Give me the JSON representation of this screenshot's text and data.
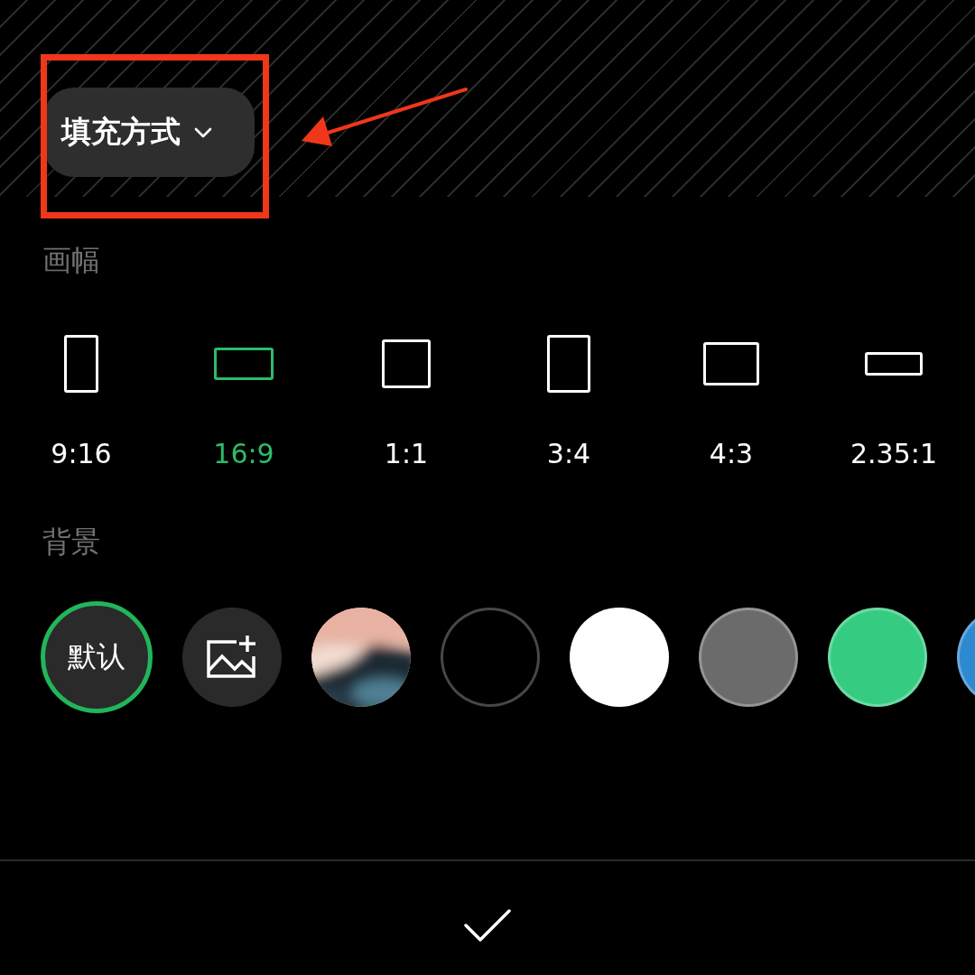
{
  "fill_mode_button": {
    "label": "填充方式"
  },
  "canvas_section": {
    "title": "画幅"
  },
  "aspect_ratios": [
    {
      "label": "9:16",
      "kind": "tall",
      "selected": false
    },
    {
      "label": "16:9",
      "kind": "wide",
      "selected": true
    },
    {
      "label": "1:1",
      "kind": "square",
      "selected": false
    },
    {
      "label": "3:4",
      "kind": "portrait",
      "selected": false
    },
    {
      "label": "4:3",
      "kind": "landscape",
      "selected": false
    },
    {
      "label": "2.35:1",
      "kind": "panorama",
      "selected": false
    }
  ],
  "background_section": {
    "title": "背景"
  },
  "backgrounds": [
    {
      "kind": "default",
      "label": "默认",
      "selected": true
    },
    {
      "kind": "add-image",
      "selected": false
    },
    {
      "kind": "picture",
      "selected": false
    },
    {
      "kind": "color",
      "color": "#000000",
      "selected": false
    },
    {
      "kind": "color",
      "color": "#ffffff",
      "selected": false
    },
    {
      "kind": "color",
      "color": "#6b6b6b",
      "selected": false
    },
    {
      "kind": "color",
      "color": "#35cc82",
      "selected": false
    },
    {
      "kind": "color",
      "color": "#2d8ad0",
      "selected": false
    }
  ]
}
